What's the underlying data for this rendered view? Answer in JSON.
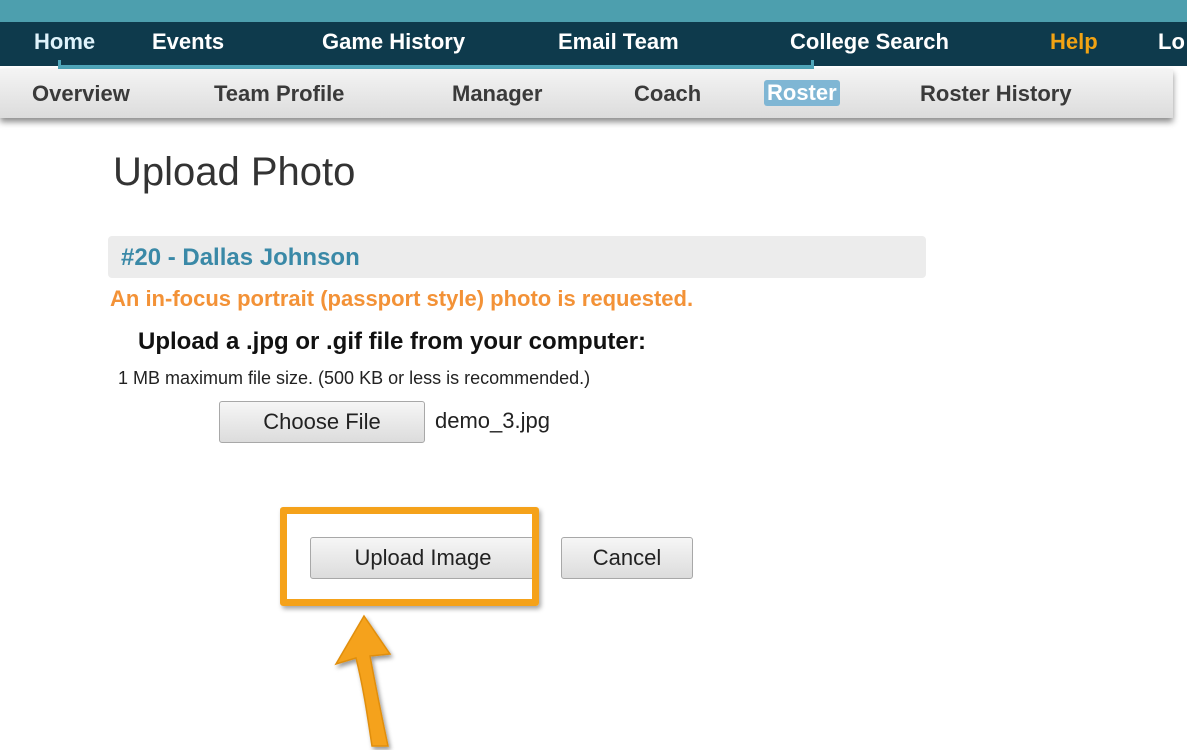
{
  "main_nav": {
    "items": [
      "Home",
      "Events",
      "Game History",
      "Email Team",
      "College Search",
      "Help",
      "Lo"
    ]
  },
  "sub_nav": {
    "items": [
      "Overview",
      "Team Profile",
      "Manager",
      "Coach",
      "Roster",
      "Roster History"
    ],
    "active": "Roster"
  },
  "page": {
    "title": "Upload Photo",
    "player": "#20 - Dallas Johnson",
    "request_note": "An in-focus portrait (passport style) photo is requested.",
    "upload_heading": "Upload a .jpg or .gif file from your computer:",
    "size_note": "1 MB maximum file size. (500 KB or less is recommended.)"
  },
  "file_input": {
    "button_label": "Choose File",
    "selected_file": "demo_3.jpg"
  },
  "actions": {
    "upload_label": "Upload Image",
    "cancel_label": "Cancel"
  },
  "colors": {
    "nav_bg": "#0e3a4c",
    "top_strip": "#4d9fae",
    "help": "#f2a313",
    "player_name": "#3a89a7",
    "request_note": "#f39237",
    "highlight": "#f5a21a",
    "active_tab": "#7fb6d4"
  },
  "annotation": {
    "highlight_icon": "highlight-box",
    "pointer_icon": "arrow-up-icon"
  }
}
